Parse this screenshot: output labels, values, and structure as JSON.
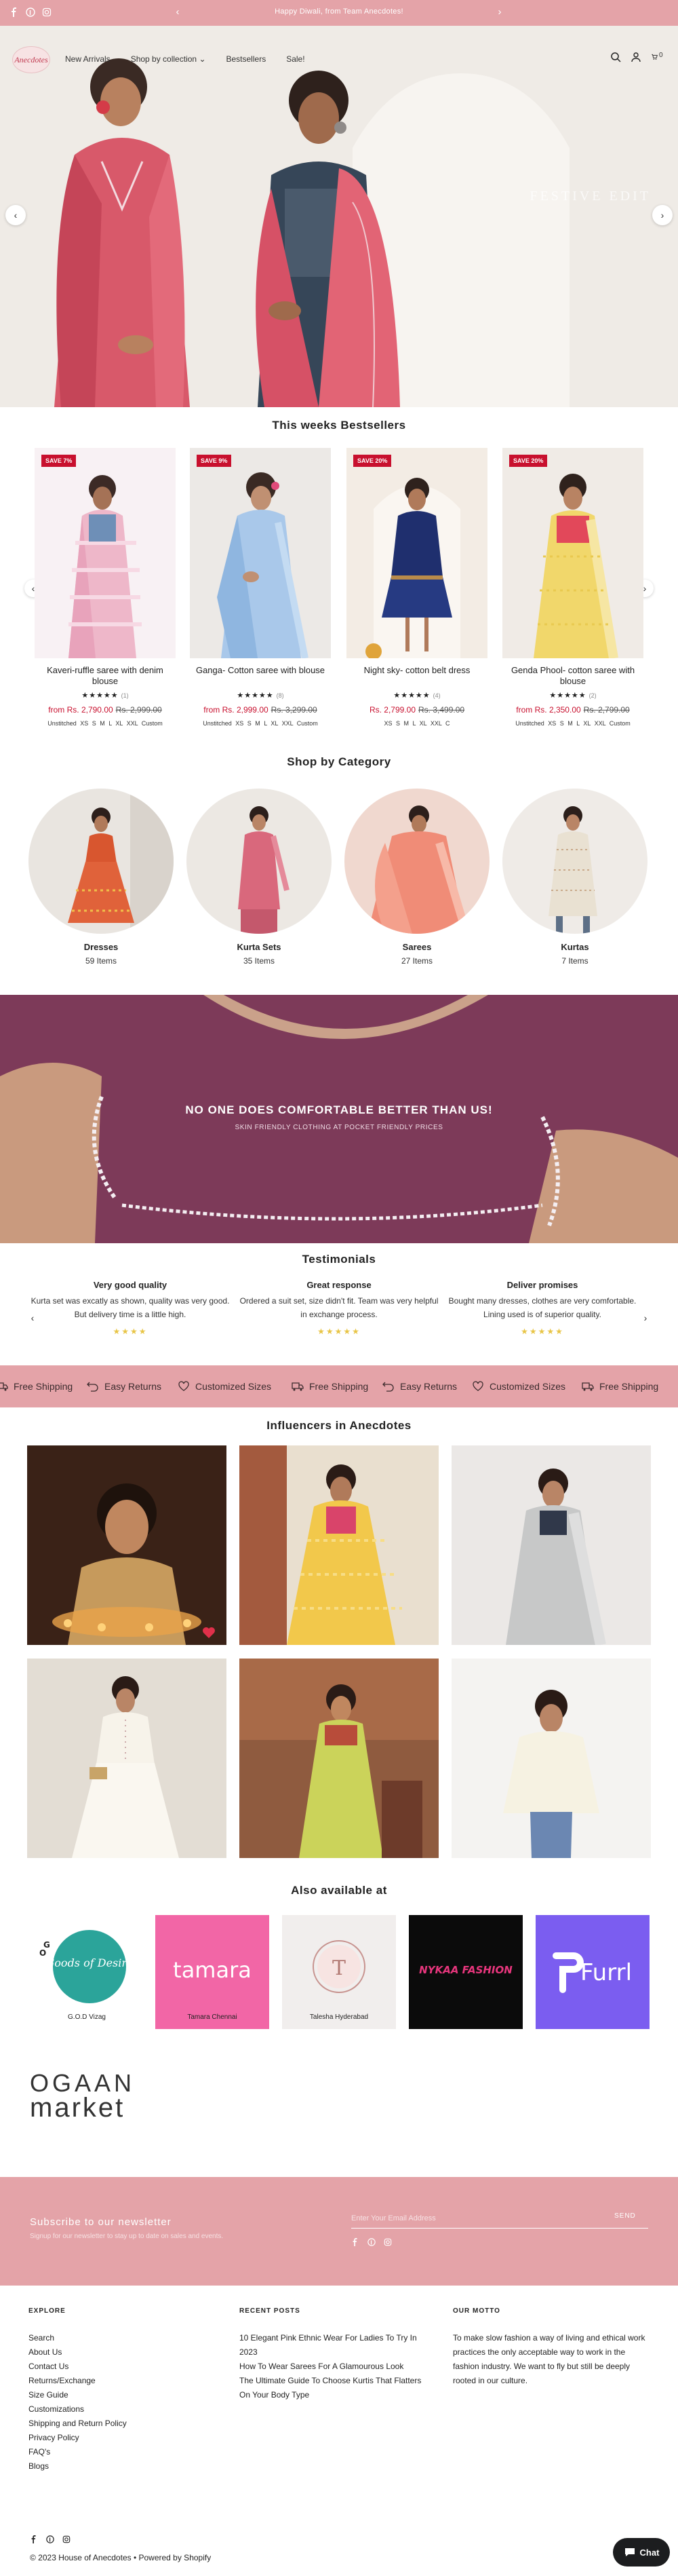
{
  "announcement": {
    "text": "Happy Diwali, from Team Anecdotes!"
  },
  "header": {
    "logo_text": "Anecdotes",
    "nav": [
      "New Arrivals",
      "Shop by collection",
      "Bestsellers",
      "Sale!"
    ],
    "cart_count": "0"
  },
  "hero": {
    "watermark": "FESTIVE EDIT"
  },
  "bestsellers": {
    "title": "This weeks Bestsellers",
    "products": [
      {
        "badge": "SAVE 7%",
        "title": "Kaveri-ruffle saree with denim blouse",
        "stars": "★★★★★",
        "reviews": "(1)",
        "price": "from Rs. 2,790.00",
        "compare": "Rs. 2,999.00",
        "sizes": "Unstitched  XS  S  M  L  XL  XXL  Custom"
      },
      {
        "badge": "SAVE 9%",
        "title": "Ganga- Cotton saree with blouse",
        "stars": "★★★★★",
        "reviews": "(8)",
        "price": "from Rs. 2,999.00",
        "compare": "Rs. 3,299.00",
        "sizes": "Unstitched  XS  S  M  L  XL  XXL  Custom"
      },
      {
        "badge": "SAVE 20%",
        "title": "Night sky- cotton belt dress",
        "stars": "★★★★★",
        "reviews": "(4)",
        "price": "Rs. 2,799.00",
        "compare": "Rs. 3,499.00",
        "sizes": "XS  S  M  L  XL  XXL  C"
      },
      {
        "badge": "SAVE 20%",
        "title": "Genda Phool- cotton saree with blouse",
        "stars": "★★★★★",
        "reviews": "(2)",
        "price": "from Rs. 2,350.00",
        "compare": "Rs. 2,799.00",
        "sizes": "Unstitched  XS  S  M  L  XL  XXL  Custom"
      }
    ]
  },
  "categories": {
    "title": "Shop by Category",
    "items": [
      {
        "name": "Dresses",
        "count": "59 Items"
      },
      {
        "name": "Kurta Sets",
        "count": "35 Items"
      },
      {
        "name": "Sarees",
        "count": "27 Items"
      },
      {
        "name": "Kurtas",
        "count": "7 Items"
      }
    ]
  },
  "banner": {
    "title": "NO ONE DOES COMFORTABLE BETTER THAN US!",
    "subtitle": "SKIN FRIENDLY CLOTHING AT POCKET FRIENDLY PRICES"
  },
  "testimonials": {
    "title": "Testimonials",
    "items": [
      {
        "title": "Very good quality",
        "body": "Kurta set was excatly as shown, quality was very good. But delivery time is a little high.",
        "stars": "★★★★"
      },
      {
        "title": "Great response",
        "body": "Ordered a suit set, size didn't fit. Team was very helpful in exchange process.",
        "stars": "★★★★★"
      },
      {
        "title": "Deliver promises",
        "body": "Bought many dresses, clothes are very comfortable. Lining used is of superior quality.",
        "stars": "★★★★★"
      }
    ]
  },
  "marquee": {
    "items": [
      "Free Shipping",
      "Easy Returns",
      "Customized Sizes",
      "Free Shipping",
      "Easy Returns",
      "Customized Sizes",
      "Free Shipping"
    ]
  },
  "influencers": {
    "title": "Influencers in Anecdotes"
  },
  "stores": {
    "title": "Also available at",
    "items": [
      {
        "label": "G.O.D Vizag",
        "brand": "Goods of Desire"
      },
      {
        "label": "Tamara Chennai",
        "brand": "tamara"
      },
      {
        "label": "Talesha Hyderabad",
        "brand": "T"
      },
      {
        "label": "",
        "brand": "NYKAA FASHION"
      },
      {
        "label": "",
        "brand": "Furrl"
      }
    ],
    "ogaan": [
      "OGAAN",
      "market"
    ]
  },
  "newsletter": {
    "title": "Subscribe to our newsletter",
    "subtitle": "Signup for our newsletter to stay up to date on sales and events.",
    "placeholder": "Enter Your Email Address",
    "button": "SEND"
  },
  "footer": {
    "explore_title": "EXPLORE",
    "explore": [
      "Search",
      "About Us",
      "Contact Us",
      "Returns/Exchange",
      "Size Guide",
      "Customizations",
      "Shipping and Return Policy",
      "Privacy Policy",
      "FAQ's",
      "Blogs"
    ],
    "posts_title": "RECENT POSTS",
    "posts": [
      "10 Elegant Pink Ethnic Wear For Ladies To Try In 2023",
      "How To Wear Sarees For A Glamourous Look",
      "The Ultimate Guide To Choose Kurtis That Flatters On Your Body Type"
    ],
    "motto_title": "OUR MOTTO",
    "motto": "To make slow fashion a way of living and ethical work practices the only acceptable way to work in the fashion industry. We want to fly but still be deeply rooted in our culture.",
    "copyright": "© 2023 House of Anecdotes • Powered by Shopify",
    "chat": "Chat"
  }
}
